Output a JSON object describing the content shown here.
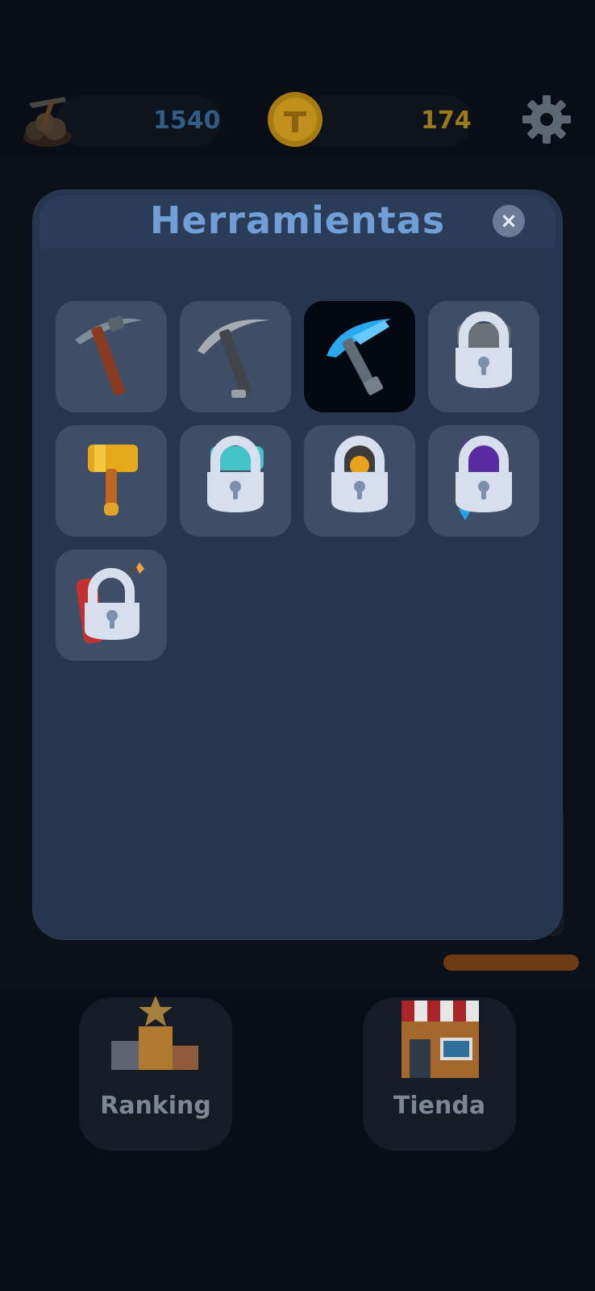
{
  "resources": {
    "ore_icon": "ore-pile-icon",
    "ore_count": "1540",
    "ore_color": "#2f5d86",
    "coin_icon": "gold-coin-icon",
    "coin_count": "174",
    "coin_color": "#9b7a1c"
  },
  "settings": {
    "icon": "gear-icon"
  },
  "modal": {
    "title": "Herramientas",
    "close_label": "×",
    "tools": [
      {
        "icon": "iron-pickaxe-icon",
        "locked": false,
        "selected": false
      },
      {
        "icon": "steel-pickaxe-icon",
        "locked": false,
        "selected": false
      },
      {
        "icon": "diamond-pickaxe-icon",
        "locked": false,
        "selected": true
      },
      {
        "icon": "drill-icon",
        "locked": true,
        "selected": false
      },
      {
        "icon": "golden-hammer-icon",
        "locked": false,
        "selected": false
      },
      {
        "icon": "crystal-tool-icon",
        "locked": true,
        "selected": false
      },
      {
        "icon": "orange-tool-icon",
        "locked": true,
        "selected": false
      },
      {
        "icon": "purple-tool-icon",
        "locked": true,
        "selected": false
      },
      {
        "icon": "dynamite-icon",
        "locked": true,
        "selected": false
      }
    ]
  },
  "bottom_nav": {
    "ranking_label": "Ranking",
    "ranking_icon": "podium-icon",
    "shop_label": "Tienda",
    "shop_icon": "shop-icon"
  }
}
